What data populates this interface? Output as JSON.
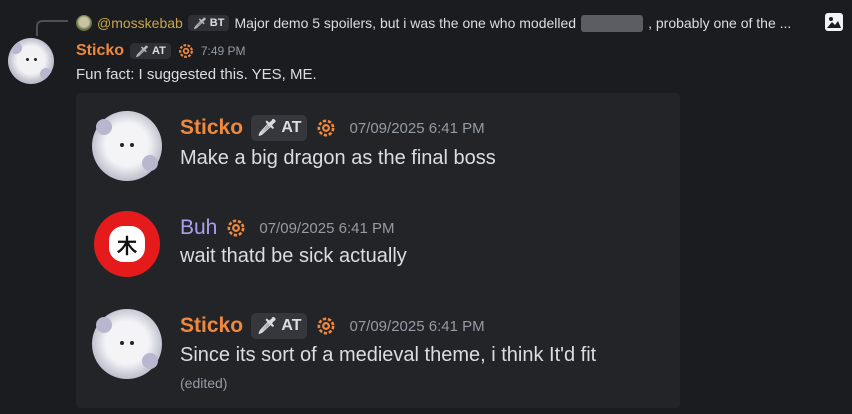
{
  "reply": {
    "username": "@mosskebab",
    "tag": "BT",
    "text_before": "Major demo 5 spoilers, but i was the one who modelled",
    "text_after": ", probably one of the ..."
  },
  "message": {
    "username": "Sticko",
    "tag": "AT",
    "timestamp": "7:49 PM",
    "text": "Fun fact: I suggested this. YES, ME."
  },
  "embed": {
    "messages": [
      {
        "username": "Sticko",
        "tag": "AT",
        "timestamp": "07/09/2025 6:41 PM",
        "text": "Make a big dragon as the final boss"
      },
      {
        "username": "Buh",
        "timestamp": "07/09/2025 6:41 PM",
        "text": "wait thatd be sick actually"
      },
      {
        "username": "Sticko",
        "tag": "AT",
        "timestamp": "07/09/2025 6:41 PM",
        "text": "Since its sort of a medieval theme, i think It'd fit",
        "edited": "(edited)"
      }
    ]
  },
  "colors": {
    "username_orange": "#f0883e",
    "username_purple": "#a7a2ef",
    "background": "#1b1c1f",
    "card": "#232428"
  },
  "icons": [
    "image-icon",
    "gear-icon",
    "sword-icon"
  ]
}
